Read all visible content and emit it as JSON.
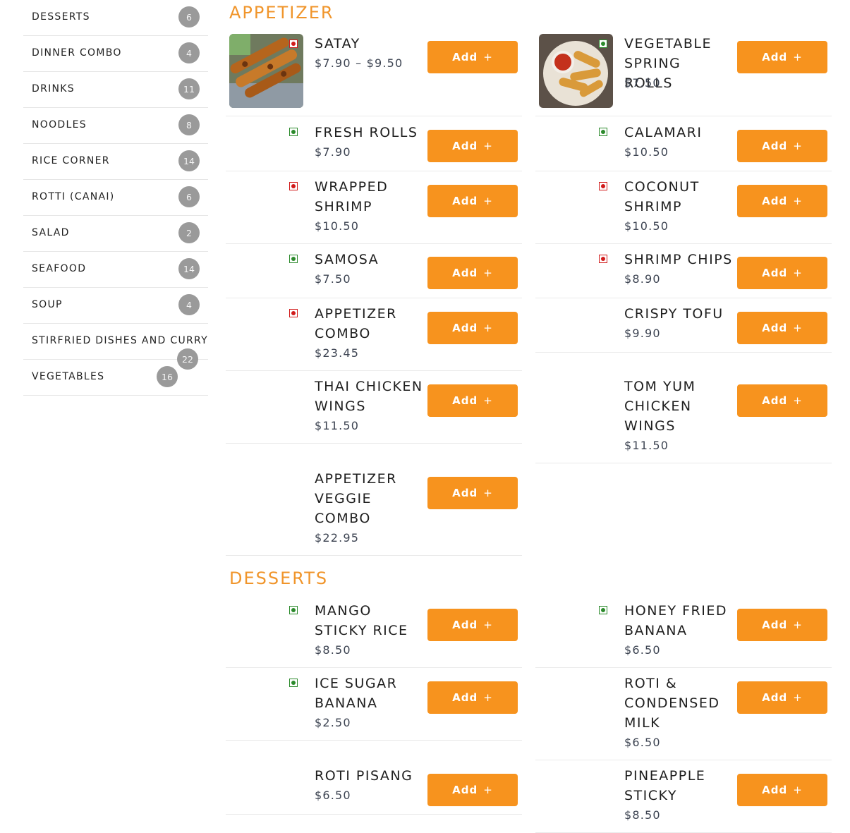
{
  "categories": [
    {
      "label": "DESSERTS",
      "count": "6"
    },
    {
      "label": "DINNER COMBO",
      "count": "4"
    },
    {
      "label": "DRINKS",
      "count": "11"
    },
    {
      "label": "NOODLES",
      "count": "8"
    },
    {
      "label": "RICE CORNER",
      "count": "14"
    },
    {
      "label": "ROTTI (CANAI)",
      "count": "6"
    },
    {
      "label": "SALAD",
      "count": "2"
    },
    {
      "label": "SEAFOOD",
      "count": "14"
    },
    {
      "label": "SOUP",
      "count": "4"
    },
    {
      "label": "STIRFRIED DISHES AND CURRY",
      "count": "22"
    },
    {
      "label": "VEGETABLES",
      "count": "16"
    }
  ],
  "add_label": "Add",
  "add_icon": "+",
  "colors": {
    "accent": "#f7931e",
    "section_title": "#f0952b",
    "veg": "#2c8a2c",
    "nonveg": "#d11a1a",
    "badge": "#9a9a9a"
  },
  "sections": {
    "appetizer": {
      "title": "APPETIZER",
      "left": [
        {
          "name_lines": [
            "SATAY"
          ],
          "price": "$7.90 – $9.50",
          "diet": "nonveg",
          "image": "satay"
        },
        {
          "name_lines": [
            "FRESH ROLLS"
          ],
          "price": "$7.90",
          "diet": "veg"
        },
        {
          "name_lines": [
            "WRAPPED",
            "SHRIMP"
          ],
          "price": "$10.50",
          "diet": "nonveg"
        },
        {
          "name_lines": [
            "SAMOSA"
          ],
          "price": "$7.50",
          "diet": "veg"
        },
        {
          "name_lines": [
            "APPETIZER",
            "COMBO"
          ],
          "price": "$23.45",
          "diet": "nonveg"
        },
        {
          "name_lines": [
            "THAI CHICKEN",
            "WINGS"
          ],
          "price": "$11.50"
        },
        {
          "name_lines": [
            "APPETIZER",
            "VEGGIE",
            "COMBO"
          ],
          "price": "$22.95"
        }
      ],
      "right": [
        {
          "name_lines": [
            "VEGETABLE",
            "SPRING ROLLS"
          ],
          "price": "$7.50",
          "diet": "veg",
          "image": "spring-rolls"
        },
        {
          "name_lines": [
            "CALAMARI"
          ],
          "price": "$10.50",
          "diet": "veg"
        },
        {
          "name_lines": [
            "COCONUT",
            "SHRIMP"
          ],
          "price": "$10.50",
          "diet": "nonveg"
        },
        {
          "name_lines": [
            "SHRIMP CHIPS"
          ],
          "price": "$8.90",
          "diet": "nonveg"
        },
        {
          "name_lines": [
            "CRISPY TOFU"
          ],
          "price": "$9.90"
        },
        {
          "name_lines": [
            "TOM YUM",
            "CHICKEN",
            "WINGS"
          ],
          "price": "$11.50"
        }
      ]
    },
    "desserts": {
      "title": "DESSERTS",
      "left": [
        {
          "name_lines": [
            "MANGO",
            "STICKY RICE"
          ],
          "price": "$8.50",
          "diet": "veg"
        },
        {
          "name_lines": [
            "ICE SUGAR",
            "BANANA"
          ],
          "price": "$2.50",
          "diet": "veg"
        },
        {
          "name_lines": [
            "ROTI PISANG"
          ],
          "price": "$6.50"
        }
      ],
      "right": [
        {
          "name_lines": [
            "HONEY FRIED",
            "BANANA"
          ],
          "price": "$6.50",
          "diet": "veg"
        },
        {
          "name_lines": [
            "ROTI &",
            "CONDENSED",
            "MILK"
          ],
          "price": "$6.50"
        },
        {
          "name_lines": [
            "PINEAPPLE",
            "STICKY"
          ],
          "price": "$8.50"
        }
      ]
    }
  }
}
